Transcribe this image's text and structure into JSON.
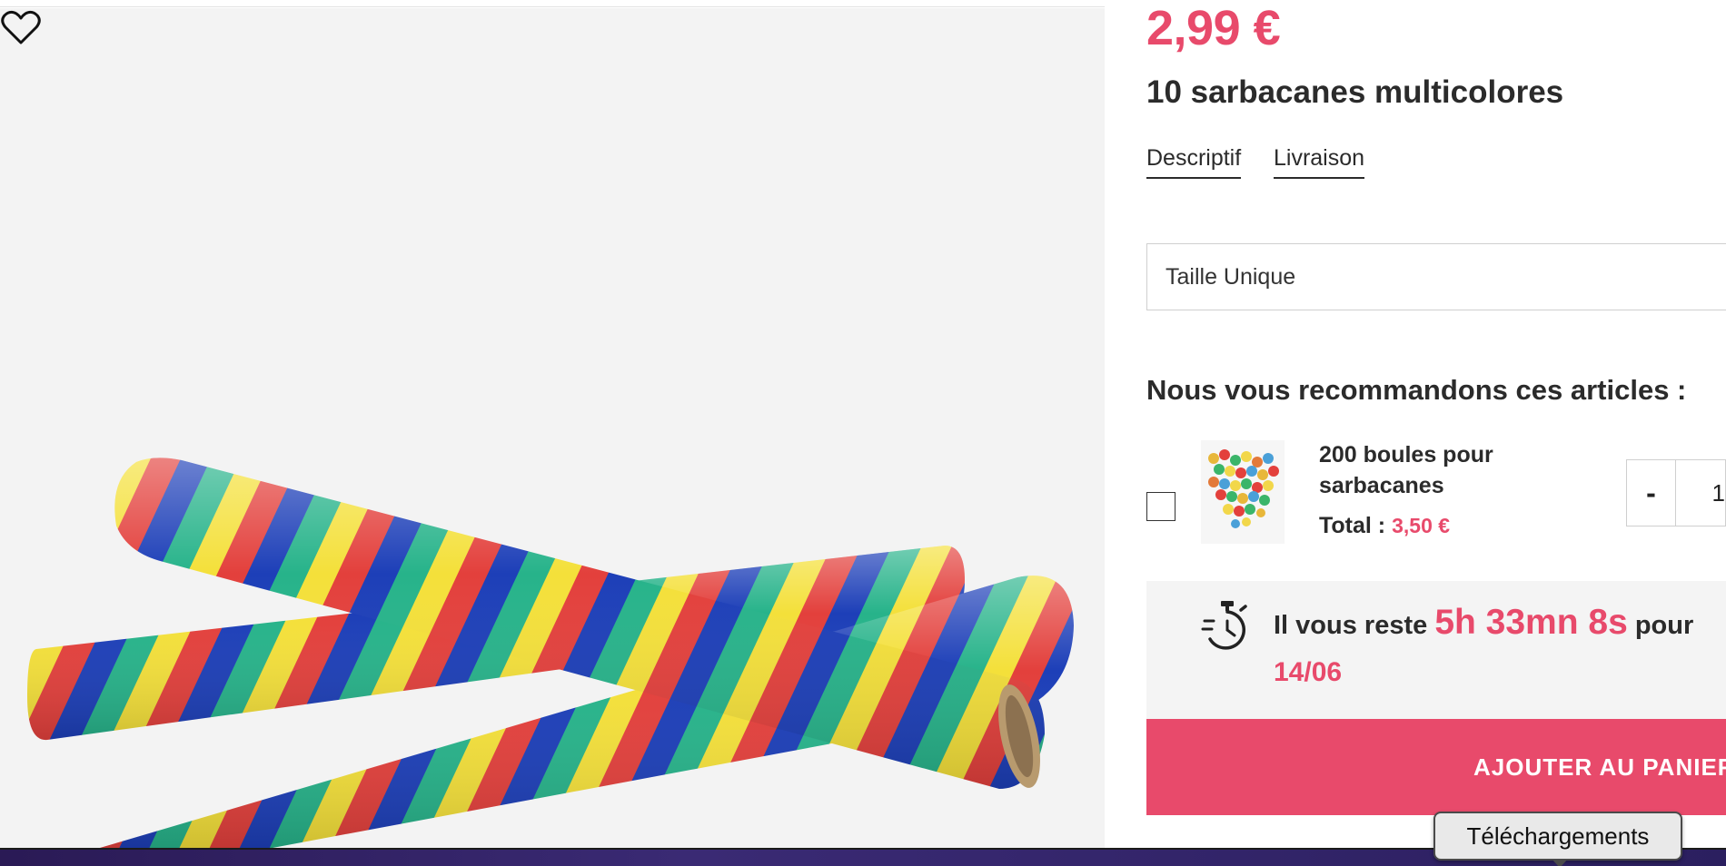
{
  "product": {
    "price": "2,99 €",
    "title": "10 sarbacanes multicolores",
    "tabs": [
      {
        "label": "Descriptif"
      },
      {
        "label": "Livraison"
      }
    ],
    "size_select_value": "Taille Unique",
    "image_alt_icon": "striped-blowpipes-image",
    "favorite_icon": "heart-icon"
  },
  "recommendations": {
    "title": "Nous vous recommandons ces articles :",
    "items": [
      {
        "name": "200 boules pour sarbacanes",
        "total_label": "Total :",
        "total_amount": "3,50 €",
        "quantity_minus": "-",
        "quantity_value": "1",
        "checked": false
      }
    ]
  },
  "delivery_timer": {
    "prefix": "Il vous reste",
    "countdown": "5h 33mn 8s",
    "suffix": "pour",
    "date": "14/06",
    "icon": "stopwatch-icon"
  },
  "cart_button": {
    "label": "AJOUTER AU PANIER"
  },
  "os": {
    "downloads_tooltip": "Téléchargements"
  },
  "colors": {
    "accent": "#e84a6b",
    "text": "#2b2b2b",
    "image_bg": "#f3f3f3"
  }
}
